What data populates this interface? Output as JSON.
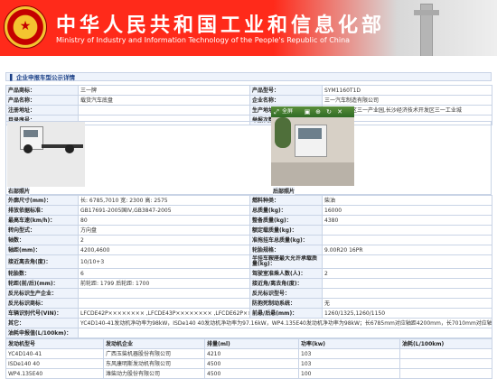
{
  "header": {
    "title_cn": "中华人民共和国工业和信息化部",
    "title_en": "Ministry of Industry and Information Technology of the People's Republic of China",
    "emblem_text": "★"
  },
  "section": {
    "marker": "▌",
    "title": "企业申报车型公示详情"
  },
  "top_rows": [
    [
      "产品商标：",
      "三一牌",
      "产品型号：",
      "SYM1160T1D"
    ],
    [
      "产品名称：",
      "载货汽车底盘",
      "企业名称：",
      "三一汽车制造有限公司"
    ],
    [
      "注册地址：",
      "",
      "生产地址：",
      "长沙市望城区三一产业园,长沙经济技术开发区三一工业城"
    ],
    [
      "目录序号：",
      "",
      "举报次数：",
      ""
    ]
  ],
  "photos": {
    "right_label": "右部照片",
    "rear_label": "后部照片",
    "toolbar_label": "全屏"
  },
  "spec_rows": [
    [
      "外廓尺寸(mm)：",
      "长: 6785,7010 宽: 2300 高: 2575",
      "燃料种类：",
      "柴油"
    ],
    [
      "排放依据标准：",
      "GB17691-2005国IV,GB3847-2005",
      "总质量(kg)：",
      "16000"
    ],
    [
      "最高车速(km/h)：",
      "80",
      "整备质量(kg)：",
      "4380"
    ],
    [
      "转向型式：",
      "方向盘",
      "额定载质量(kg)：",
      ""
    ],
    [
      "轴数：",
      "2",
      "准拖挂车总质量(kg)：",
      ""
    ],
    [
      "轴距(mm)：",
      "4200,4600",
      "轮胎规格：",
      "9.00R20 16PR"
    ],
    [
      "接近离去角(度)：",
      "10/10+3",
      "半挂车鞍座最大允许承载质量(kg)：",
      ""
    ],
    [
      "轮胎数：",
      "6",
      "驾驶室准乘人数(人)：",
      "2"
    ],
    [
      "轮距(前/后)(mm)：",
      "前轮距: 1799 后轮距: 1700",
      "接近角/离去角(度)：",
      ""
    ],
    [
      "反光标识生产企业：",
      "",
      "反光标识型号：",
      ""
    ],
    [
      "反光标识商标：",
      "",
      "防抱死制动系统：",
      "无"
    ],
    [
      "车辆识别代号(VIN)：",
      "LFCDE42P×××××××× ,LFCDE43P×××××××× ,LFCDE62P×××××××× ,LFCDE63P××××××××",
      "前悬/后悬(mm)：",
      "1260/1325,1260/1150"
    ],
    [
      "其它：",
      "YC4D140-41发动机净功率为98kW，ISDe140 40发动机净功率为97.16kW，WP4.135E40发动机净功率为98kW；长6785mm对应轴距4200mm，长7010mm对应轴距4600mm",
      "",
      ""
    ],
    [
      "油耗申报值(L/100km)：",
      "",
      "",
      ""
    ]
  ],
  "engine": {
    "headers": [
      "发动机型号",
      "发动机企业",
      "排量(ml)",
      "功率(kw)",
      "油耗(L/100km)"
    ],
    "rows": [
      [
        "YC4D140-41",
        "广西玉柴机器股份有限公司",
        "4210",
        "103",
        ""
      ],
      [
        "ISDe140 40",
        "东风康明斯发动机有限公司",
        "4500",
        "103",
        ""
      ],
      [
        "WP4.135E40",
        "潍柴动力股份有限公司",
        "4500",
        "100",
        ""
      ]
    ]
  }
}
